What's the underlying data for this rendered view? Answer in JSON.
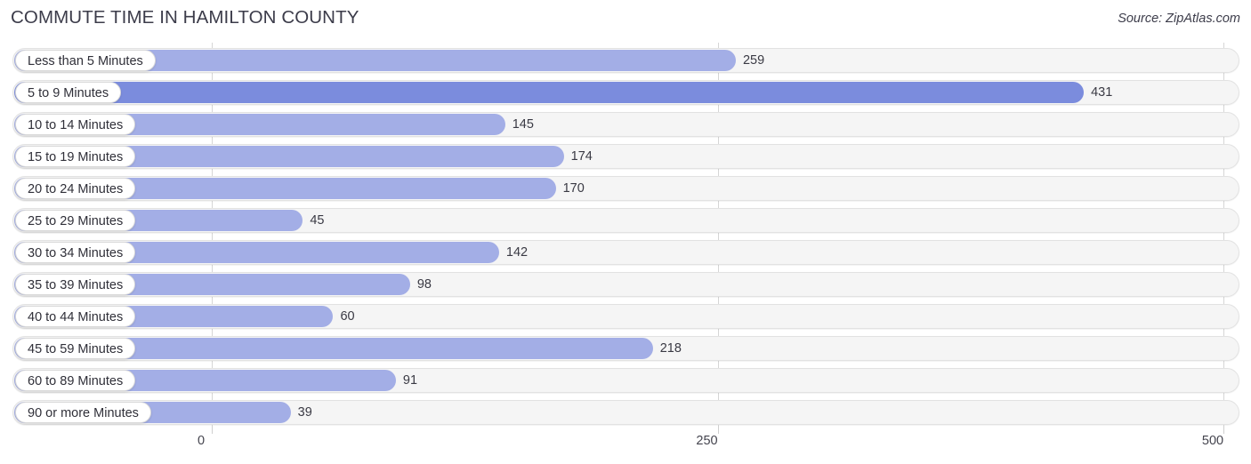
{
  "header": {
    "title": "COMMUTE TIME IN HAMILTON COUNTY",
    "source": "Source: ZipAtlas.com"
  },
  "colors": {
    "bar": "#a3aee6",
    "bar_highlight": "#7b8cdd",
    "track": "#f5f5f5",
    "track_border": "#e2e2e2",
    "gridline": "#d6d6d6",
    "text": "#3c3c4a",
    "value_inside_text": "#ffffff"
  },
  "chart_data": {
    "type": "bar",
    "orientation": "horizontal",
    "title": "COMMUTE TIME IN HAMILTON COUNTY",
    "subtitle": "",
    "xlabel": "",
    "ylabel": "",
    "xlim": [
      0,
      500
    ],
    "xticks": [
      0,
      250,
      500
    ],
    "xtick_labels": [
      "0",
      "250",
      "500"
    ],
    "grid": true,
    "legend": false,
    "categories": [
      "Less than 5 Minutes",
      "5 to 9 Minutes",
      "10 to 14 Minutes",
      "15 to 19 Minutes",
      "20 to 24 Minutes",
      "25 to 29 Minutes",
      "30 to 34 Minutes",
      "35 to 39 Minutes",
      "40 to 44 Minutes",
      "45 to 59 Minutes",
      "60 to 89 Minutes",
      "90 or more Minutes"
    ],
    "values": [
      259,
      431,
      145,
      174,
      170,
      45,
      142,
      98,
      60,
      218,
      91,
      39
    ],
    "value_labels": [
      "259",
      "431",
      "145",
      "174",
      "170",
      "45",
      "142",
      "98",
      "60",
      "218",
      "91",
      "39"
    ],
    "highlight_index": 1
  }
}
